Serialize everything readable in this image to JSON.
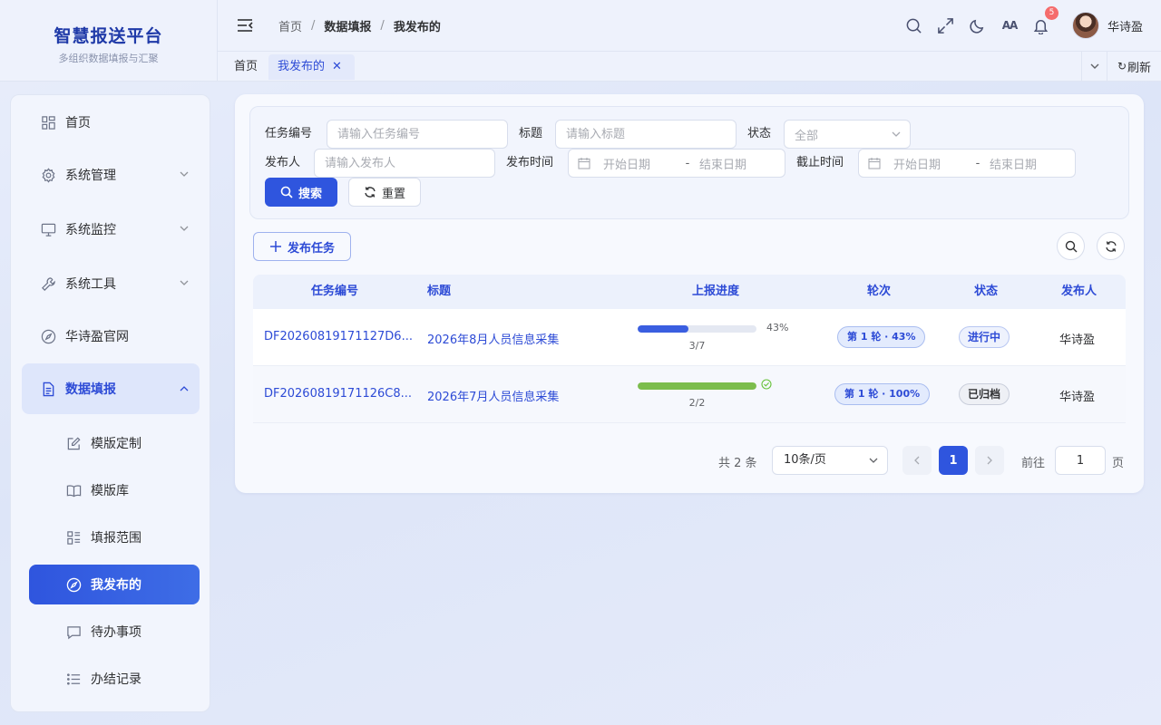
{
  "brand": {
    "title": "智慧报送平台",
    "subtitle": "多组织数据填报与汇聚"
  },
  "header": {
    "breadcrumb": [
      "首页",
      "数据填报",
      "我发布的"
    ],
    "notification_count": "5",
    "font_toggle_label": "AA",
    "username": "华诗盈"
  },
  "tabs": {
    "items": [
      {
        "label": "首页"
      },
      {
        "label": "我发布的",
        "closable": true
      }
    ],
    "refresh_label": "刷新"
  },
  "sidebar": {
    "items": [
      {
        "label": "首页",
        "icon": "grid-icon"
      },
      {
        "label": "系统管理",
        "icon": "gear-icon"
      },
      {
        "label": "系统监控",
        "icon": "monitor-icon"
      },
      {
        "label": "系统工具",
        "icon": "wrench-icon"
      },
      {
        "label": "华诗盈官网",
        "icon": "compass-icon"
      },
      {
        "label": "数据填报",
        "icon": "document-icon",
        "expanded": true
      }
    ],
    "sub_items": [
      {
        "label": "模版定制",
        "icon": "edit-icon"
      },
      {
        "label": "模版库",
        "icon": "book-icon"
      },
      {
        "label": "填报范围",
        "icon": "list-icon"
      },
      {
        "label": "我发布的",
        "icon": "compass-icon",
        "active": true
      },
      {
        "label": "待办事项",
        "icon": "message-icon"
      },
      {
        "label": "办结记录",
        "icon": "bullet-list-icon"
      }
    ]
  },
  "filter": {
    "task_no": {
      "label": "任务编号",
      "placeholder": "请输入任务编号",
      "value": ""
    },
    "title": {
      "label": "标题",
      "placeholder": "请输入标题",
      "value": ""
    },
    "status": {
      "label": "状态",
      "selected": "全部"
    },
    "publisher": {
      "label": "发布人",
      "placeholder": "请输入发布人",
      "value": ""
    },
    "publish_time": {
      "label": "发布时间",
      "start_placeholder": "开始日期",
      "separator": "-",
      "end_placeholder": "结束日期"
    },
    "deadline": {
      "label": "截止时间",
      "start_placeholder": "开始日期",
      "separator": "-",
      "end_placeholder": "结束日期"
    },
    "search_label": "搜索",
    "reset_label": "重置"
  },
  "toolbar": {
    "publish_label": "发布任务"
  },
  "table": {
    "columns": [
      "任务编号",
      "标题",
      "上报进度",
      "轮次",
      "状态",
      "发布人"
    ],
    "rows": [
      {
        "task_no": "DF20260819171127D6...",
        "title": "2026年8月人员信息采集",
        "progress": 0.43,
        "progress_text": "43%",
        "progress_count": "3/7",
        "progress_color": "#3a5ee0",
        "complete": false,
        "round": "第 1 轮 · 43%",
        "status": "进行中",
        "publisher": "华诗盈"
      },
      {
        "task_no": "DF20260819171126C8...",
        "title": "2026年7月人员信息采集",
        "progress": 1.0,
        "progress_text": "",
        "progress_count": "2/2",
        "progress_color": "#7cbd4c",
        "complete": true,
        "round": "第 1 轮 · 100%",
        "status": "已归档",
        "publisher": "华诗盈"
      }
    ]
  },
  "pagination": {
    "total": "共 2 条",
    "page_size": "10条/页",
    "current": "1",
    "goto_label": "前往",
    "goto_value": "1",
    "page_suffix": "页"
  },
  "colors": {
    "primary": "#2f55de",
    "success": "#67c23a"
  }
}
